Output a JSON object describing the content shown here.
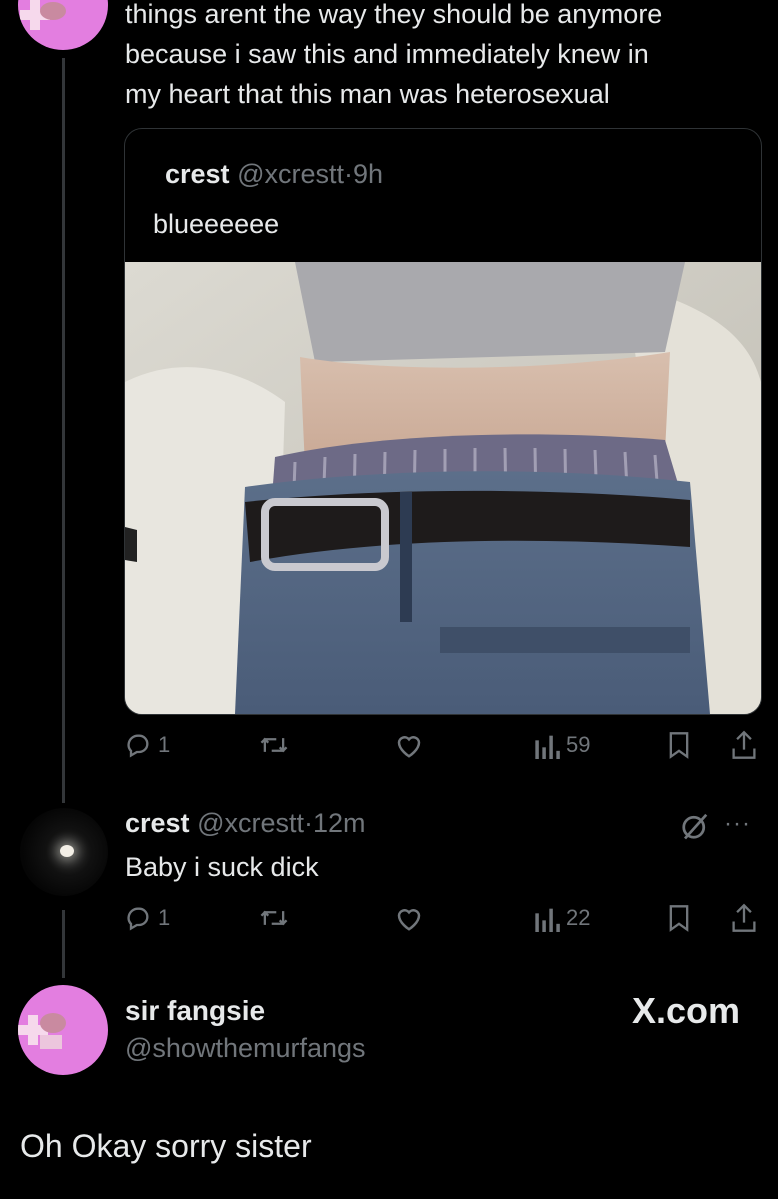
{
  "main_tweet": {
    "lines": [
      "things arent the way they should be anymore",
      "because i saw this and immediately knew in",
      "my heart that this man was heterosexual"
    ]
  },
  "quoted_tweet": {
    "name": "crest",
    "handle": "@xcrestt",
    "separator": "·",
    "time": "9h",
    "text": "blueeeeee",
    "image_description_icon": "photo-image"
  },
  "quoted_actions": {
    "reply_count": "1",
    "retweet_count": "",
    "like_count": "",
    "views_count": "59"
  },
  "reply_tweet": {
    "name": "crest",
    "handle": "@xcrestt",
    "separator": "·",
    "time": "12m",
    "text": "Baby i suck dick",
    "more_icon": "···"
  },
  "reply_actions": {
    "reply_count": "1",
    "retweet_count": "",
    "like_count": "",
    "views_count": "22"
  },
  "footer": {
    "author_name": "sir fangsie",
    "author_handle": "@showthemurfangs",
    "brand": "X.com",
    "caption": "Oh Okay sorry sister"
  },
  "colors": {
    "background": "#000000",
    "text": "#e7e9ea",
    "muted": "#71767b",
    "border": "#2f3336",
    "avatar_pink": "#e37ee0"
  }
}
